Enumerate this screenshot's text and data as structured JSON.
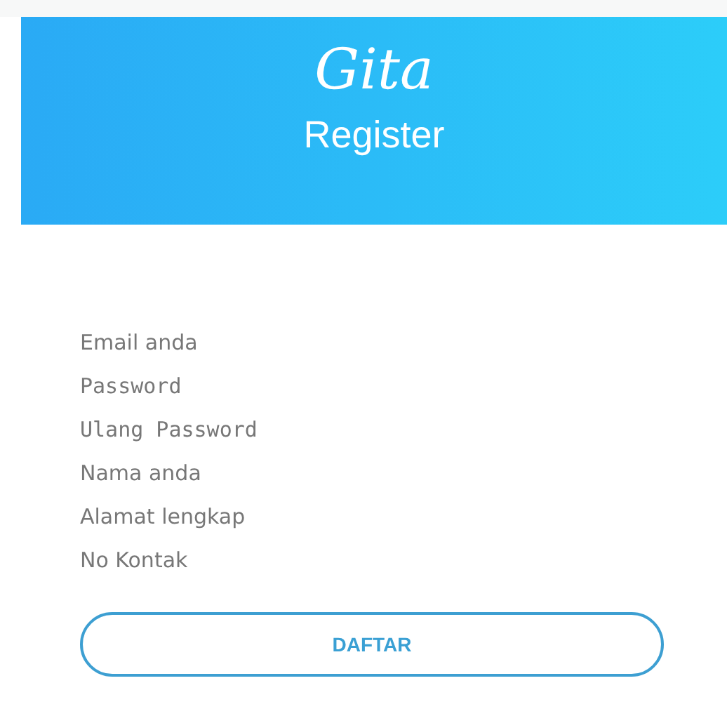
{
  "header": {
    "logo": "Gita",
    "title": "Register"
  },
  "fields": [
    {
      "kind": "text",
      "placeholder": "Email anda"
    },
    {
      "kind": "password",
      "placeholder": "Password"
    },
    {
      "kind": "password",
      "placeholder": "Ulang Password"
    },
    {
      "kind": "text",
      "placeholder": "Nama anda"
    },
    {
      "kind": "text",
      "placeholder": "Alamat lengkap"
    },
    {
      "kind": "text",
      "placeholder": "No Kontak"
    }
  ],
  "submit_button": "DAFTAR"
}
